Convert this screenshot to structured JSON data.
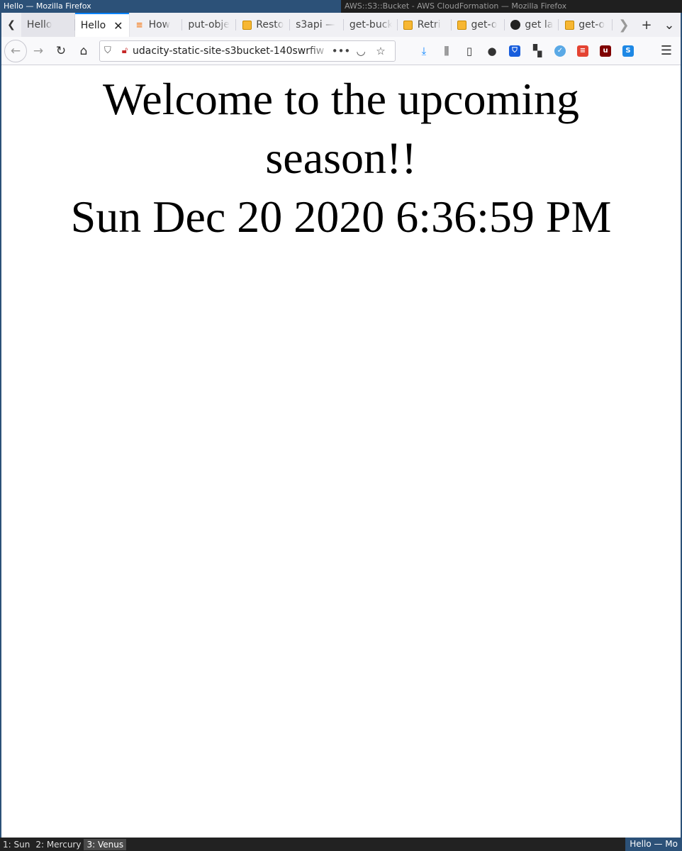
{
  "wm": {
    "left_title": "Hello — Mozilla Firefox",
    "right_title": "AWS::S3::Bucket - AWS CloudFormation — Mozilla Firefox",
    "workspaces": [
      "1: Sun",
      "2: Mercury",
      "3: Venus"
    ],
    "status_right": "Hello — Mo"
  },
  "tabs": [
    {
      "label": "Hello",
      "icon": "none"
    },
    {
      "label": "Hello",
      "icon": "none",
      "active": true
    },
    {
      "label": "How",
      "icon": "stackoverflow-icon"
    },
    {
      "label": "put-obje",
      "icon": "none"
    },
    {
      "label": "Resto",
      "icon": "aws-box-icon"
    },
    {
      "label": "s3api —",
      "icon": "none"
    },
    {
      "label": "get-buck",
      "icon": "none"
    },
    {
      "label": "Retri",
      "icon": "aws-box-icon"
    },
    {
      "label": "get-o",
      "icon": "aws-box-icon"
    },
    {
      "label": "get la",
      "icon": "github-icon"
    },
    {
      "label": "get-o",
      "icon": "aws-box-icon"
    }
  ],
  "nav": {
    "url": "udacity-static-site-s3bucket-140swrfiw"
  },
  "page": {
    "heading": "Welcome to the upcoming season!!",
    "timestamp": "Sun Dec 20 2020 6:36:59 PM"
  },
  "colors": {
    "active_window": "#2c5178",
    "active_tab_accent": "#0a84ff"
  }
}
